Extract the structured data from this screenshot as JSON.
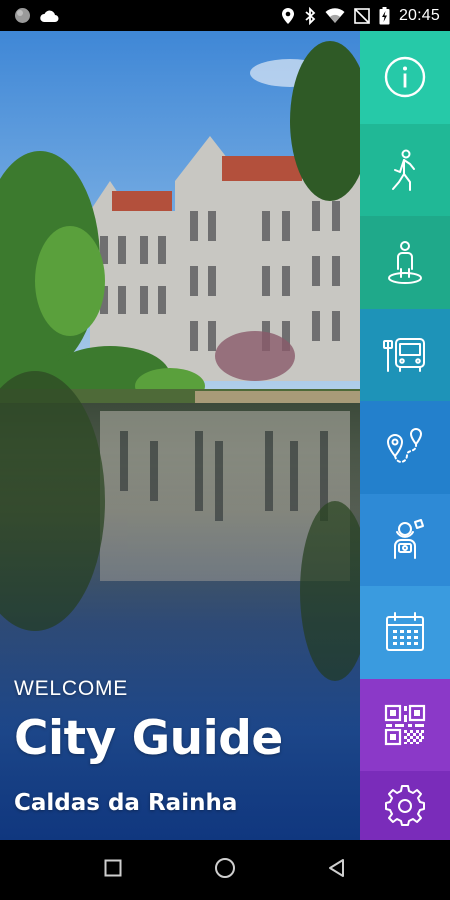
{
  "status_bar": {
    "time": "20:45",
    "left_icons": [
      "circle-icon",
      "cloud-icon"
    ],
    "right_icons": [
      "location-icon",
      "bluetooth-icon",
      "wifi-icon",
      "no-sim-icon",
      "battery-icon"
    ]
  },
  "hero": {
    "welcome": "WELCOME",
    "title": "City Guide",
    "city": "Caldas da Rainha"
  },
  "menu": {
    "items": [
      {
        "icon": "info-icon",
        "color": "#26c9a8"
      },
      {
        "icon": "walking-person-icon",
        "color": "#20b896"
      },
      {
        "icon": "person-on-map-icon",
        "color": "#1fa98a"
      },
      {
        "icon": "bus-icon",
        "color": "#1e93b8"
      },
      {
        "icon": "route-pins-icon",
        "color": "#2380cc"
      },
      {
        "icon": "tourist-icon",
        "color": "#2e8ad6"
      },
      {
        "icon": "calendar-icon",
        "color": "#3a9bdf"
      },
      {
        "icon": "qr-code-icon",
        "color": "#8b39c8"
      },
      {
        "icon": "settings-gear-icon",
        "color": "#7a2cba"
      }
    ]
  },
  "nav_bar": {
    "icons": [
      "recents-icon",
      "home-icon",
      "back-icon"
    ]
  }
}
